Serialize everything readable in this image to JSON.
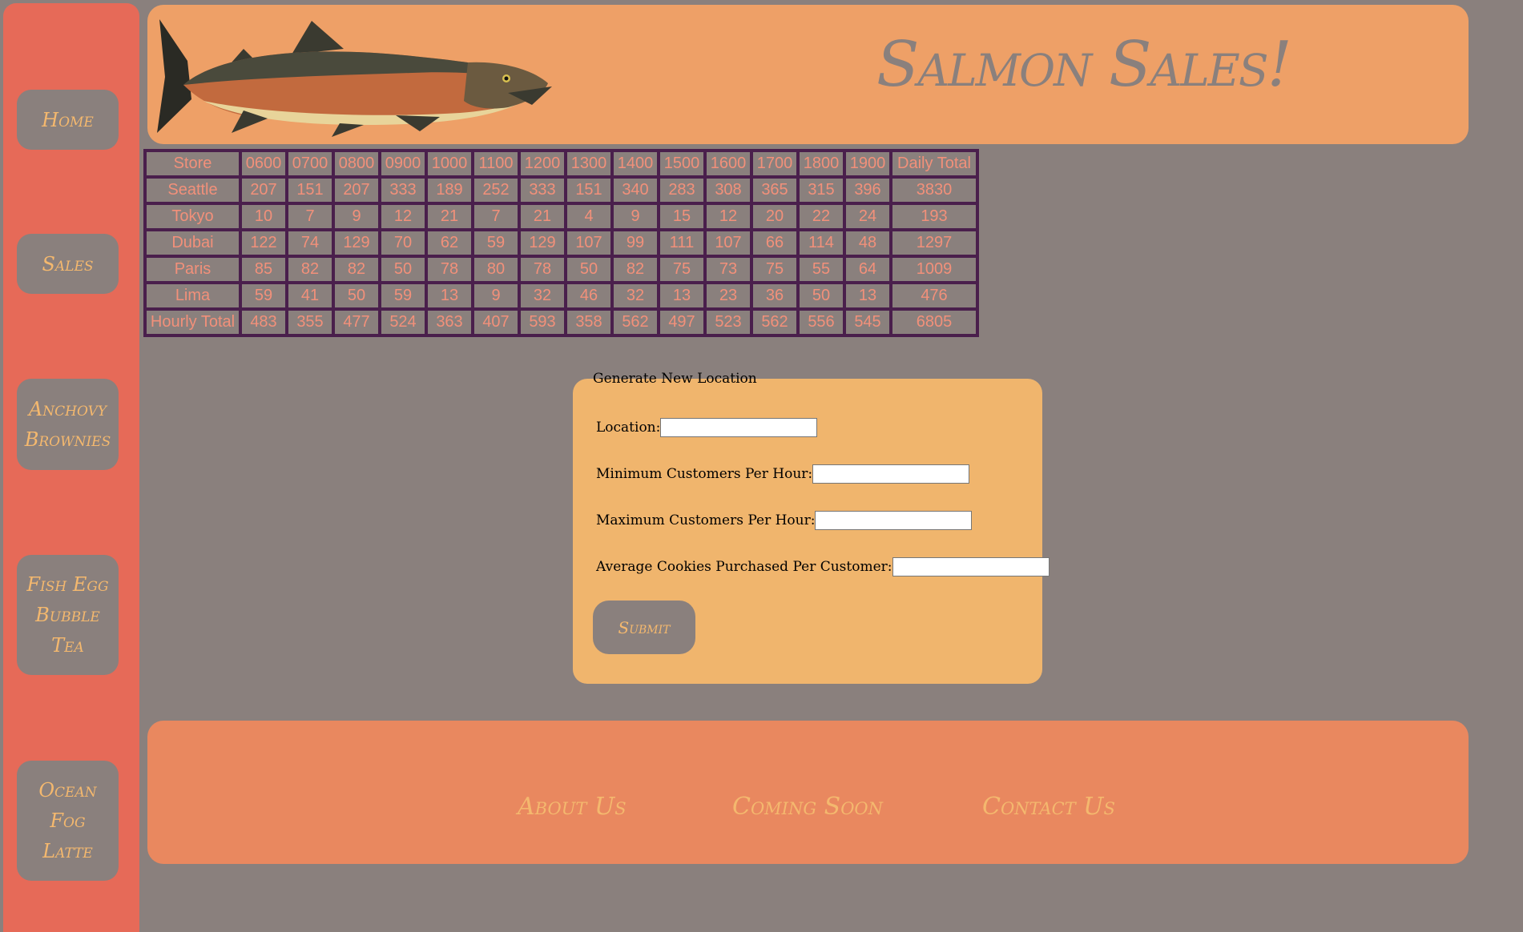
{
  "nav": {
    "items": [
      {
        "label": "Home"
      },
      {
        "label": "Sales"
      },
      {
        "label": "Anchovy Brownies"
      },
      {
        "label": "Fish Egg Bubble Tea"
      },
      {
        "label": "Ocean Fog Latte"
      }
    ]
  },
  "header": {
    "title": "Salmon Sales!",
    "logo_icon": "salmon-fish-illustration"
  },
  "table": {
    "headers": [
      "Store",
      "0600",
      "0700",
      "0800",
      "0900",
      "1000",
      "1100",
      "1200",
      "1300",
      "1400",
      "1500",
      "1600",
      "1700",
      "1800",
      "1900",
      "Daily Total"
    ],
    "rows": [
      [
        "Seattle",
        "207",
        "151",
        "207",
        "333",
        "189",
        "252",
        "333",
        "151",
        "340",
        "283",
        "308",
        "365",
        "315",
        "396",
        "3830"
      ],
      [
        "Tokyo",
        "10",
        "7",
        "9",
        "12",
        "21",
        "7",
        "21",
        "4",
        "9",
        "15",
        "12",
        "20",
        "22",
        "24",
        "193"
      ],
      [
        "Dubai",
        "122",
        "74",
        "129",
        "70",
        "62",
        "59",
        "129",
        "107",
        "99",
        "111",
        "107",
        "66",
        "114",
        "48",
        "1297"
      ],
      [
        "Paris",
        "85",
        "82",
        "82",
        "50",
        "78",
        "80",
        "78",
        "50",
        "82",
        "75",
        "73",
        "75",
        "55",
        "64",
        "1009"
      ],
      [
        "Lima",
        "59",
        "41",
        "50",
        "59",
        "13",
        "9",
        "32",
        "46",
        "32",
        "13",
        "23",
        "36",
        "50",
        "13",
        "476"
      ],
      [
        "Hourly Total",
        "483",
        "355",
        "477",
        "524",
        "363",
        "407",
        "593",
        "358",
        "562",
        "497",
        "523",
        "562",
        "556",
        "545",
        "6805"
      ]
    ]
  },
  "form": {
    "legend": "Generate New Location",
    "location_label": "Location:",
    "location_value": "",
    "min_label": "Minimum Customers Per Hour:",
    "min_value": "",
    "max_label": "Maximum Customers Per Hour:",
    "max_value": "",
    "avg_label": "Average Cookies Purchased Per Customer:",
    "avg_value": "",
    "submit_label": "Submit"
  },
  "footer": {
    "about": "About Us",
    "coming": "Coming Soon",
    "contact": "Contact Us"
  },
  "colors": {
    "page_bg": "#8a807d",
    "sidebar": "#e66a58",
    "header": "#eea067",
    "form_panel": "#f0b56d",
    "footer": "#e9885f",
    "accent_text": "#f4b86e",
    "table_text": "#f2907a",
    "table_border": "#4a1f4c"
  }
}
